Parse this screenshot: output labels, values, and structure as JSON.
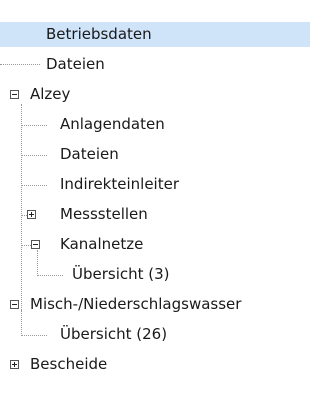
{
  "tree": {
    "items": [
      {
        "label": "Betriebsdaten",
        "selected": true
      },
      {
        "label": "Dateien"
      },
      {
        "label": "Alzey",
        "toggle": "collapse"
      },
      {
        "label": "Anlagendaten"
      },
      {
        "label": "Dateien"
      },
      {
        "label": "Indirekteinleiter"
      },
      {
        "label": "Messstellen",
        "toggle": "expand"
      },
      {
        "label": "Kanalnetze",
        "toggle": "collapse"
      },
      {
        "label": "Übersicht (3)"
      },
      {
        "label": "Misch-/Niederschlagswasser",
        "toggle": "collapse"
      },
      {
        "label": "Übersicht (26)"
      },
      {
        "label": "Bescheide",
        "toggle": "expand"
      }
    ]
  }
}
